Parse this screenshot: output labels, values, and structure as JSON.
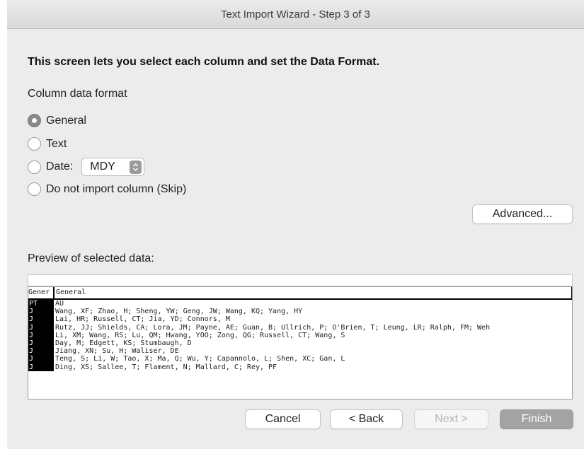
{
  "window": {
    "title": "Text Import Wizard - Step 3 of 3"
  },
  "heading": "This screen lets you select each column and set the Data Format.",
  "column_format": {
    "label": "Column data format",
    "options": [
      {
        "label": "General",
        "selected": true
      },
      {
        "label": "Text",
        "selected": false
      },
      {
        "label": "Date:",
        "selected": false
      },
      {
        "label": "Do not import column (Skip)",
        "selected": false
      }
    ],
    "date_format": {
      "value": "MDY",
      "icon": "up-down-chevron-icon"
    }
  },
  "advanced_button": "Advanced...",
  "preview": {
    "label": "Preview of selected data:",
    "headers": [
      "Gener",
      "General"
    ],
    "rows": [
      [
        "PT",
        "AU"
      ],
      [
        "J",
        "Wang, XF; Zhao, H; Sheng, YW; Geng, JW; Wang, KQ; Yang, HY"
      ],
      [
        "J",
        "Lai, HR; Russell, CT; Jia, YD; Connors, M"
      ],
      [
        "J",
        "Rutz, JJ; Shields, CA; Lora, JM; Payne, AE; Guan, B; Ullrich, P; O'Brien, T; Leung, LR; Ralph, FM; Weh"
      ],
      [
        "J",
        "Li, XM; Wang, RS; Lu, QM; Hwang, YOO; Zong, QG; Russell, CT; Wang, S"
      ],
      [
        "J",
        "Day, M; Edgett, KS; Stumbaugh, D"
      ],
      [
        "J",
        "Jiang, XN; Su, H; Waliser, DE"
      ],
      [
        "J",
        "Teng, S; Li, W; Tao, X; Ma, Q; Wu, Y; Capannolo, L; Shen, XC; Gan, L"
      ],
      [
        "J",
        "Ding, XS; Sallee, T; Flament, N; Mallard, C; Rey, PF"
      ]
    ]
  },
  "buttons": {
    "cancel": "Cancel",
    "back": "< Back",
    "next": "Next >",
    "finish": "Finish"
  }
}
